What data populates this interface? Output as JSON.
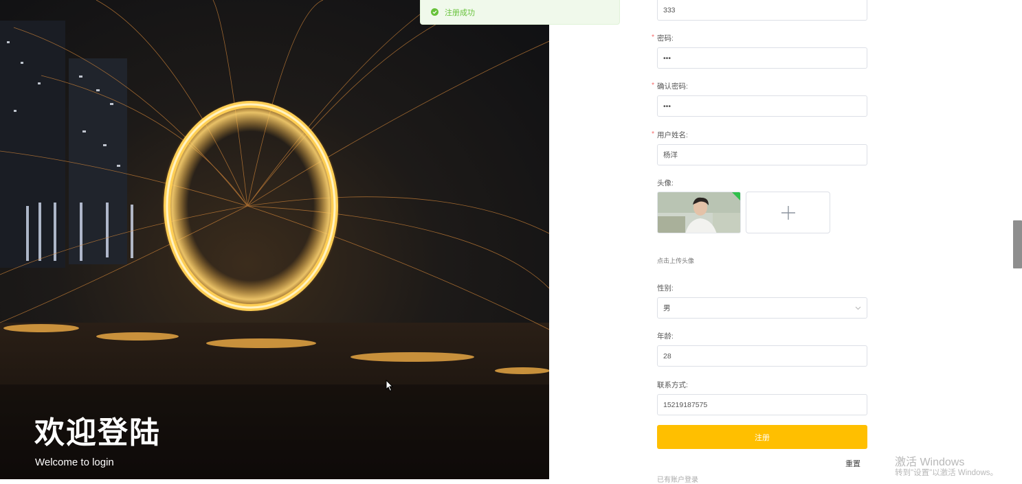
{
  "hero": {
    "title": "欢迎登陆",
    "subtitle": "Welcome to login"
  },
  "toast": {
    "icon": "check-circle-icon",
    "message": "注册成功",
    "color": "#67c23a"
  },
  "form": {
    "username_value": "333",
    "password": {
      "label": "密码:",
      "value": "•••"
    },
    "confirm_password": {
      "label": "确认密码:",
      "value": "•••"
    },
    "real_name": {
      "label": "用户姓名:",
      "value": "杨洋"
    },
    "avatar": {
      "label": "头像:",
      "hint": "点击上传头像",
      "upload_icon": "plus-icon"
    },
    "gender": {
      "label": "性别:",
      "value": "男"
    },
    "age": {
      "label": "年龄:",
      "value": "28"
    },
    "contact": {
      "label": "联系方式:",
      "value": "15219187575"
    },
    "submit_label": "注册",
    "reset_label": "重置",
    "login_link": "已有账户登录"
  },
  "colors": {
    "accent": "#ffbf00",
    "required": "#f56c6c"
  },
  "watermark": {
    "title": "激活 Windows",
    "subtitle": "转到\"设置\"以激活 Windows。"
  }
}
